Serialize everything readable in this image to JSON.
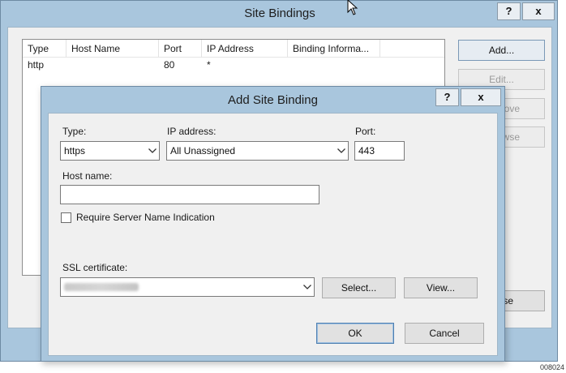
{
  "outer": {
    "title": "Site Bindings",
    "help_label": "?",
    "close_label": "x",
    "columns": [
      "Type",
      "Host Name",
      "Port",
      "IP Address",
      "Binding Informa..."
    ],
    "rows": [
      {
        "type": "http",
        "host_name": "",
        "port": "80",
        "ip_address": "*",
        "binding_info": ""
      }
    ],
    "buttons": {
      "add": "Add...",
      "edit": "Edit...",
      "remove_partial": "ove",
      "browse_partial": "wse",
      "close_partial": "se"
    }
  },
  "dialog": {
    "title": "Add Site Binding",
    "help_label": "?",
    "close_label": "x",
    "type_label": "Type:",
    "type_value": "https",
    "ip_label": "IP address:",
    "ip_value": "All Unassigned",
    "port_label": "Port:",
    "port_value": "443",
    "host_label": "Host name:",
    "host_value": "",
    "sni_label": "Require Server Name Indication",
    "sni_checked": false,
    "ssl_label": "SSL certificate:",
    "select_label": "Select...",
    "view_label": "View...",
    "ok_label": "OK",
    "cancel_label": "Cancel"
  },
  "figure_id": "008024"
}
